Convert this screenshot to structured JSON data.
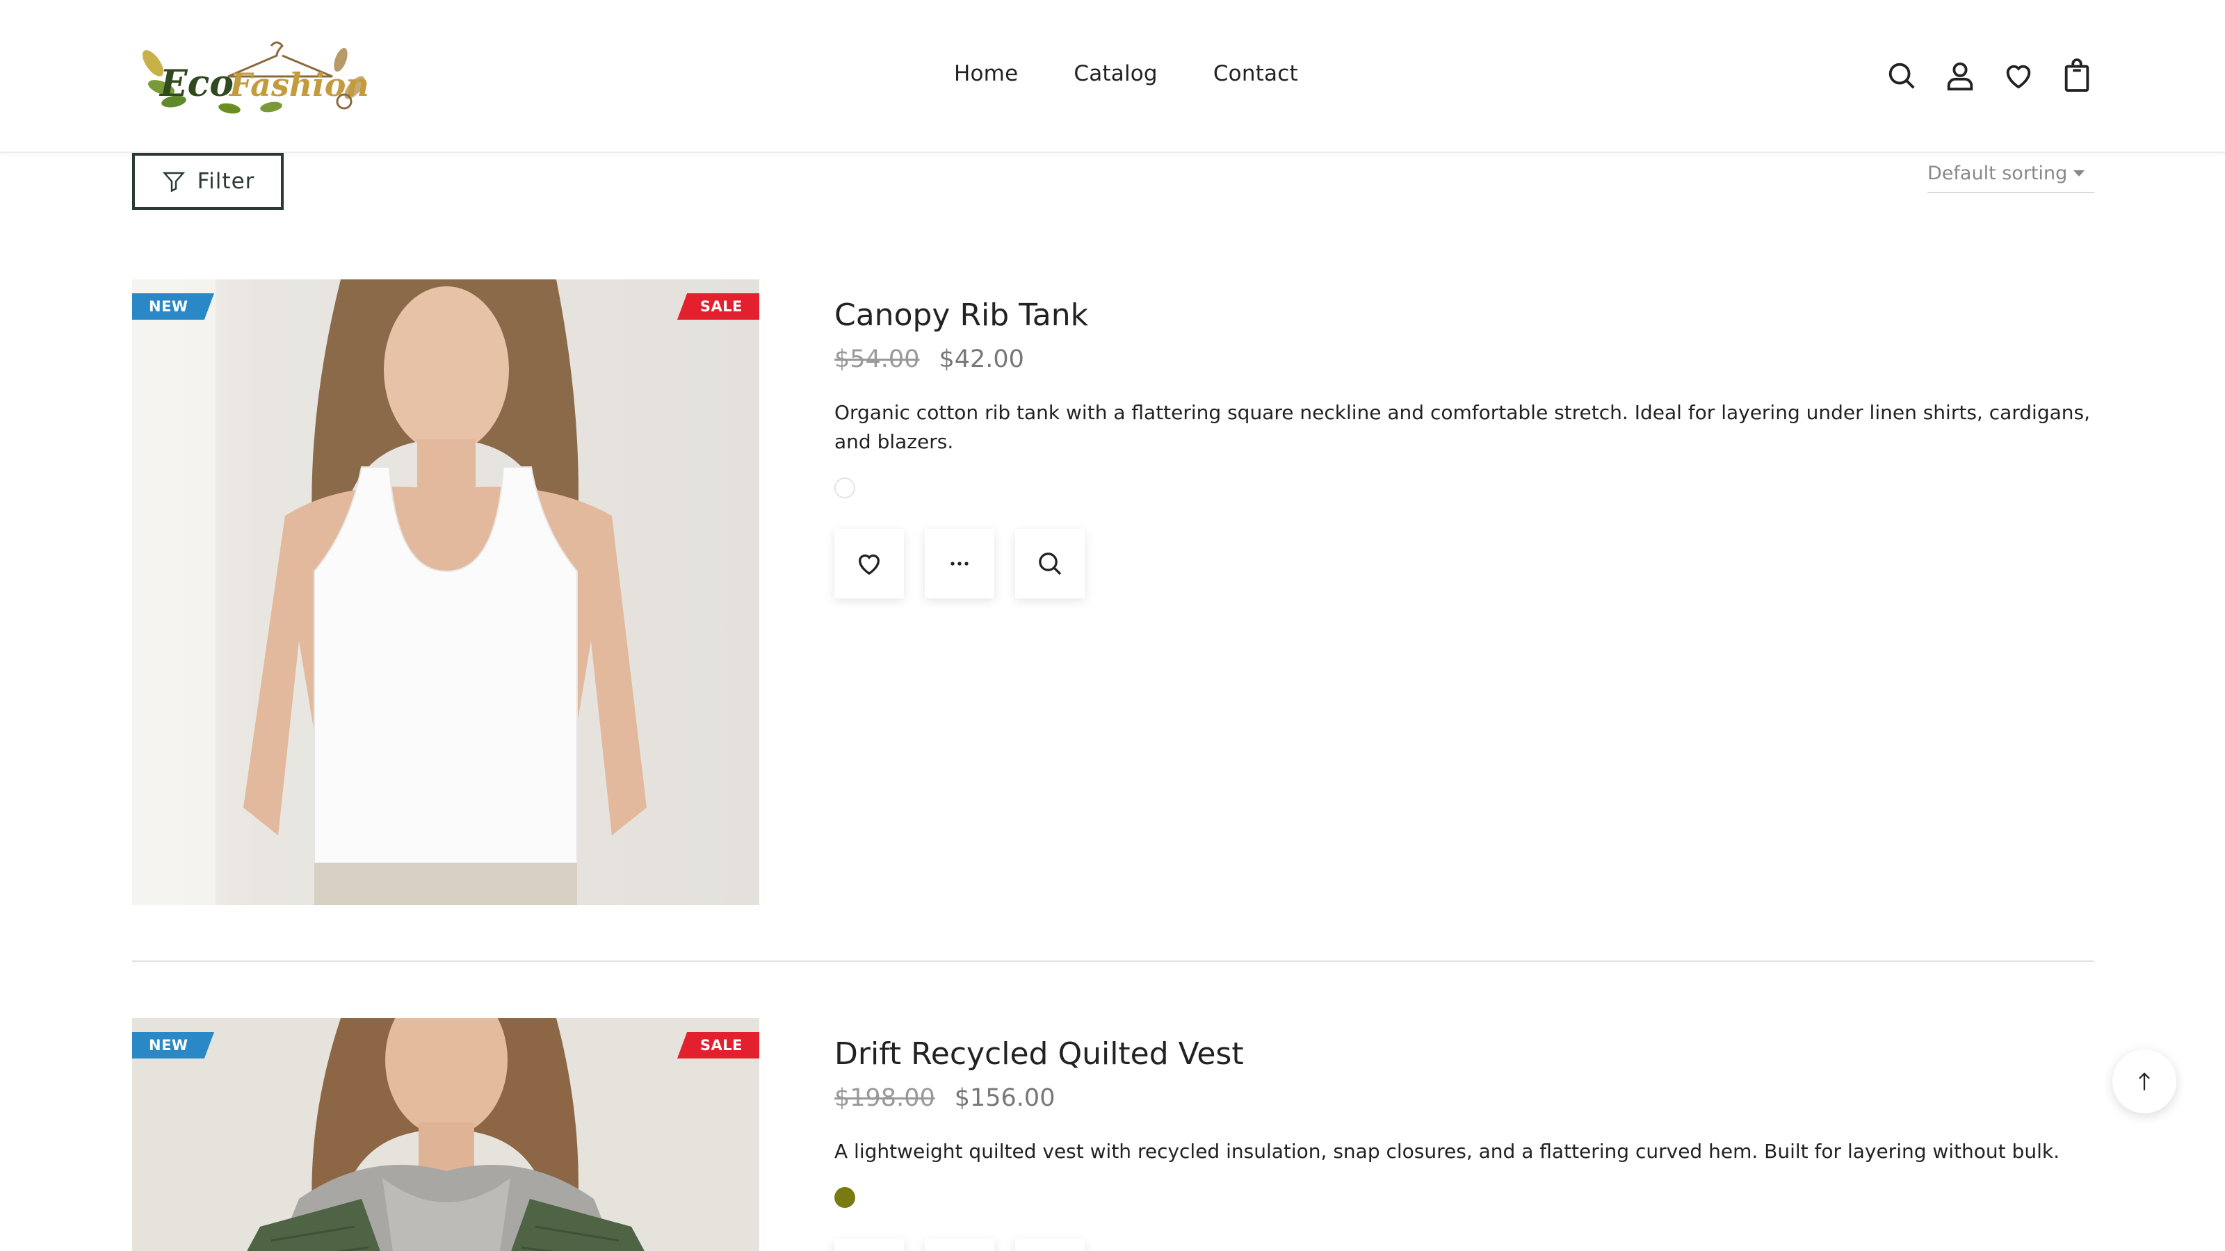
{
  "brand": {
    "logo_text_1": "Eco",
    "logo_text_2": "Fashion"
  },
  "nav": {
    "items": [
      {
        "label": "Home"
      },
      {
        "label": "Catalog"
      },
      {
        "label": "Contact"
      }
    ]
  },
  "header_icons": [
    "search-icon",
    "user-icon",
    "heart-icon",
    "bag-icon"
  ],
  "toolbar": {
    "filter_label": "Filter",
    "sorting_label": "Default sorting"
  },
  "products": [
    {
      "title": "Canopy Rib Tank",
      "old_price": "$54.00",
      "price": "$42.00",
      "description": "Organic cotton rib tank with a flattering square neckline and comfortable stretch. Ideal for layering under linen shirts, cardigans, and blazers.",
      "badge_new": "NEW",
      "badge_sale": "SALE",
      "swatch_color": "#ffffff"
    },
    {
      "title": "Drift Recycled Quilted Vest",
      "old_price": "$198.00",
      "price": "$156.00",
      "description": "A lightweight quilted vest with recycled insulation, snap closures, and a flattering curved hem. Built for layering without bulk.",
      "badge_new": "NEW",
      "badge_sale": "SALE",
      "swatch_color": "#7a7a12"
    }
  ],
  "colors": {
    "badge_new": "#2a88c6",
    "badge_sale": "#e3202d",
    "accent_dark": "#2b3a36"
  }
}
